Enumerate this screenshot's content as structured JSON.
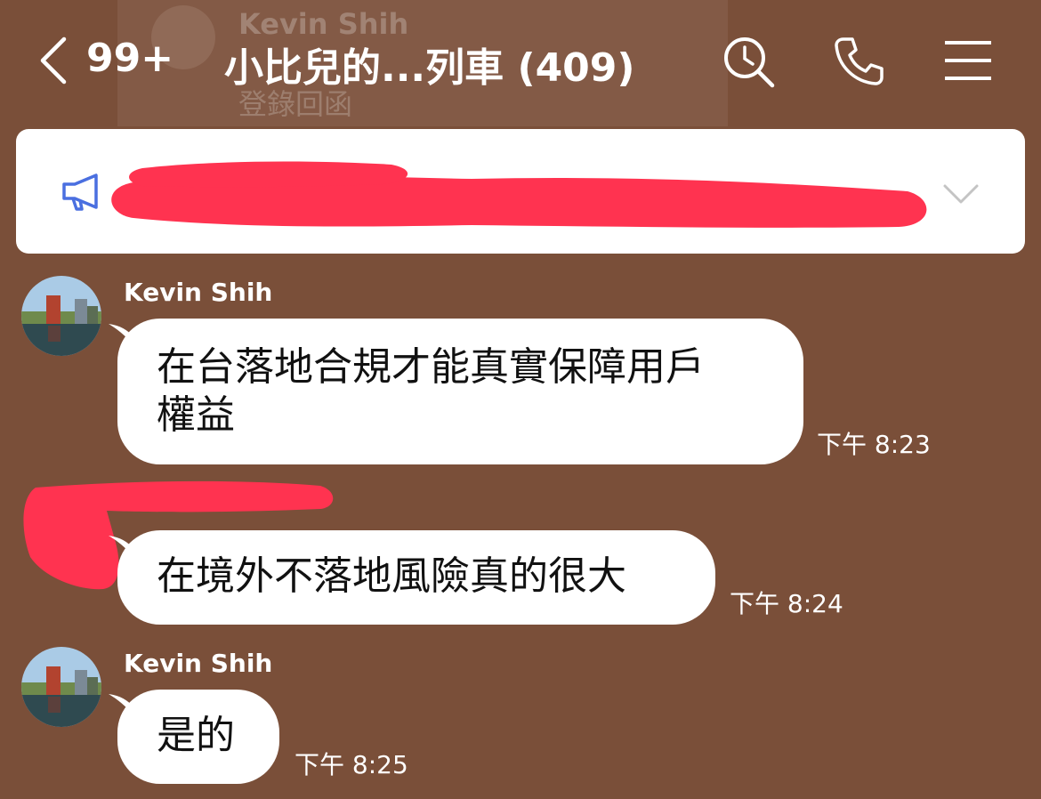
{
  "header": {
    "unread_count": "99+",
    "chat_title": "小比兒的...列車 (409)",
    "ghost_sender": "Kevin Shih",
    "ghost_subtitle": "登錄回函"
  },
  "icons": {
    "back": "chevron-left-icon",
    "search": "search-icon",
    "call": "phone-icon",
    "menu": "menu-icon",
    "announcement": "megaphone-icon",
    "expand": "chevron-down-icon"
  },
  "colors": {
    "background": "#7a4f39",
    "bubble": "#ffffff",
    "redaction": "#ff3350",
    "accent": "#4a6fe0"
  },
  "messages": [
    {
      "sender": "Kevin Shih",
      "text_line1": "在台落地合規才能真實保障用戶",
      "text_line2": "權益",
      "time": "下午 8:23"
    },
    {
      "sender": "",
      "text": "在境外不落地風險真的很大",
      "time": "下午 8:24"
    },
    {
      "sender": "Kevin Shih",
      "text": "是的",
      "time": "下午 8:25"
    }
  ]
}
